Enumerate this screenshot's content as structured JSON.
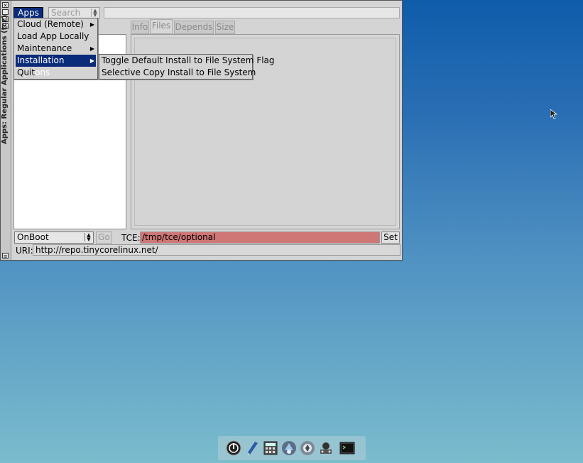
{
  "window": {
    "vertical_title": "Apps: Regular Applications (tcz)",
    "title_buttons": [
      "close-icon",
      "minimize-icon",
      "maximize-icon",
      "shade-icon",
      "menu-icon"
    ]
  },
  "toolbar": {
    "apps_label": "Apps",
    "search_select": "Search",
    "search_input_value": ""
  },
  "tabs": [
    {
      "label": "Info"
    },
    {
      "label": "Files"
    },
    {
      "label": "Depends"
    },
    {
      "label": "Size"
    }
  ],
  "bottom": {
    "onboot_value": "OnBoot",
    "go_label": "Go",
    "tce_label": "TCE:",
    "tce_value": "/tmp/tce/optional",
    "set_label": "Set",
    "uri_label": "URI:",
    "uri_value": "http://repo.tinycorelinux.net/"
  },
  "menu": {
    "items": [
      {
        "label": "Cloud (Remote)",
        "has_submenu": true
      },
      {
        "label": "Load App Locally",
        "has_submenu": false
      },
      {
        "label": "Maintenance",
        "has_submenu": true
      },
      {
        "label": "Installation Options",
        "has_submenu": true
      },
      {
        "label": "Quit",
        "has_submenu": false
      }
    ],
    "submenu_items": [
      {
        "label": "Toggle Default Install to File System Flag"
      },
      {
        "label": "Selective Copy Install to File System"
      }
    ]
  },
  "dock": {
    "icons": [
      "power-icon",
      "editor-icon",
      "calculator-icon",
      "apps-icon",
      "settings-icon",
      "network-icon",
      "terminal-icon"
    ]
  },
  "colors": {
    "menu_highlight": "#0a2b7a",
    "tce_field": "#cf7676"
  }
}
